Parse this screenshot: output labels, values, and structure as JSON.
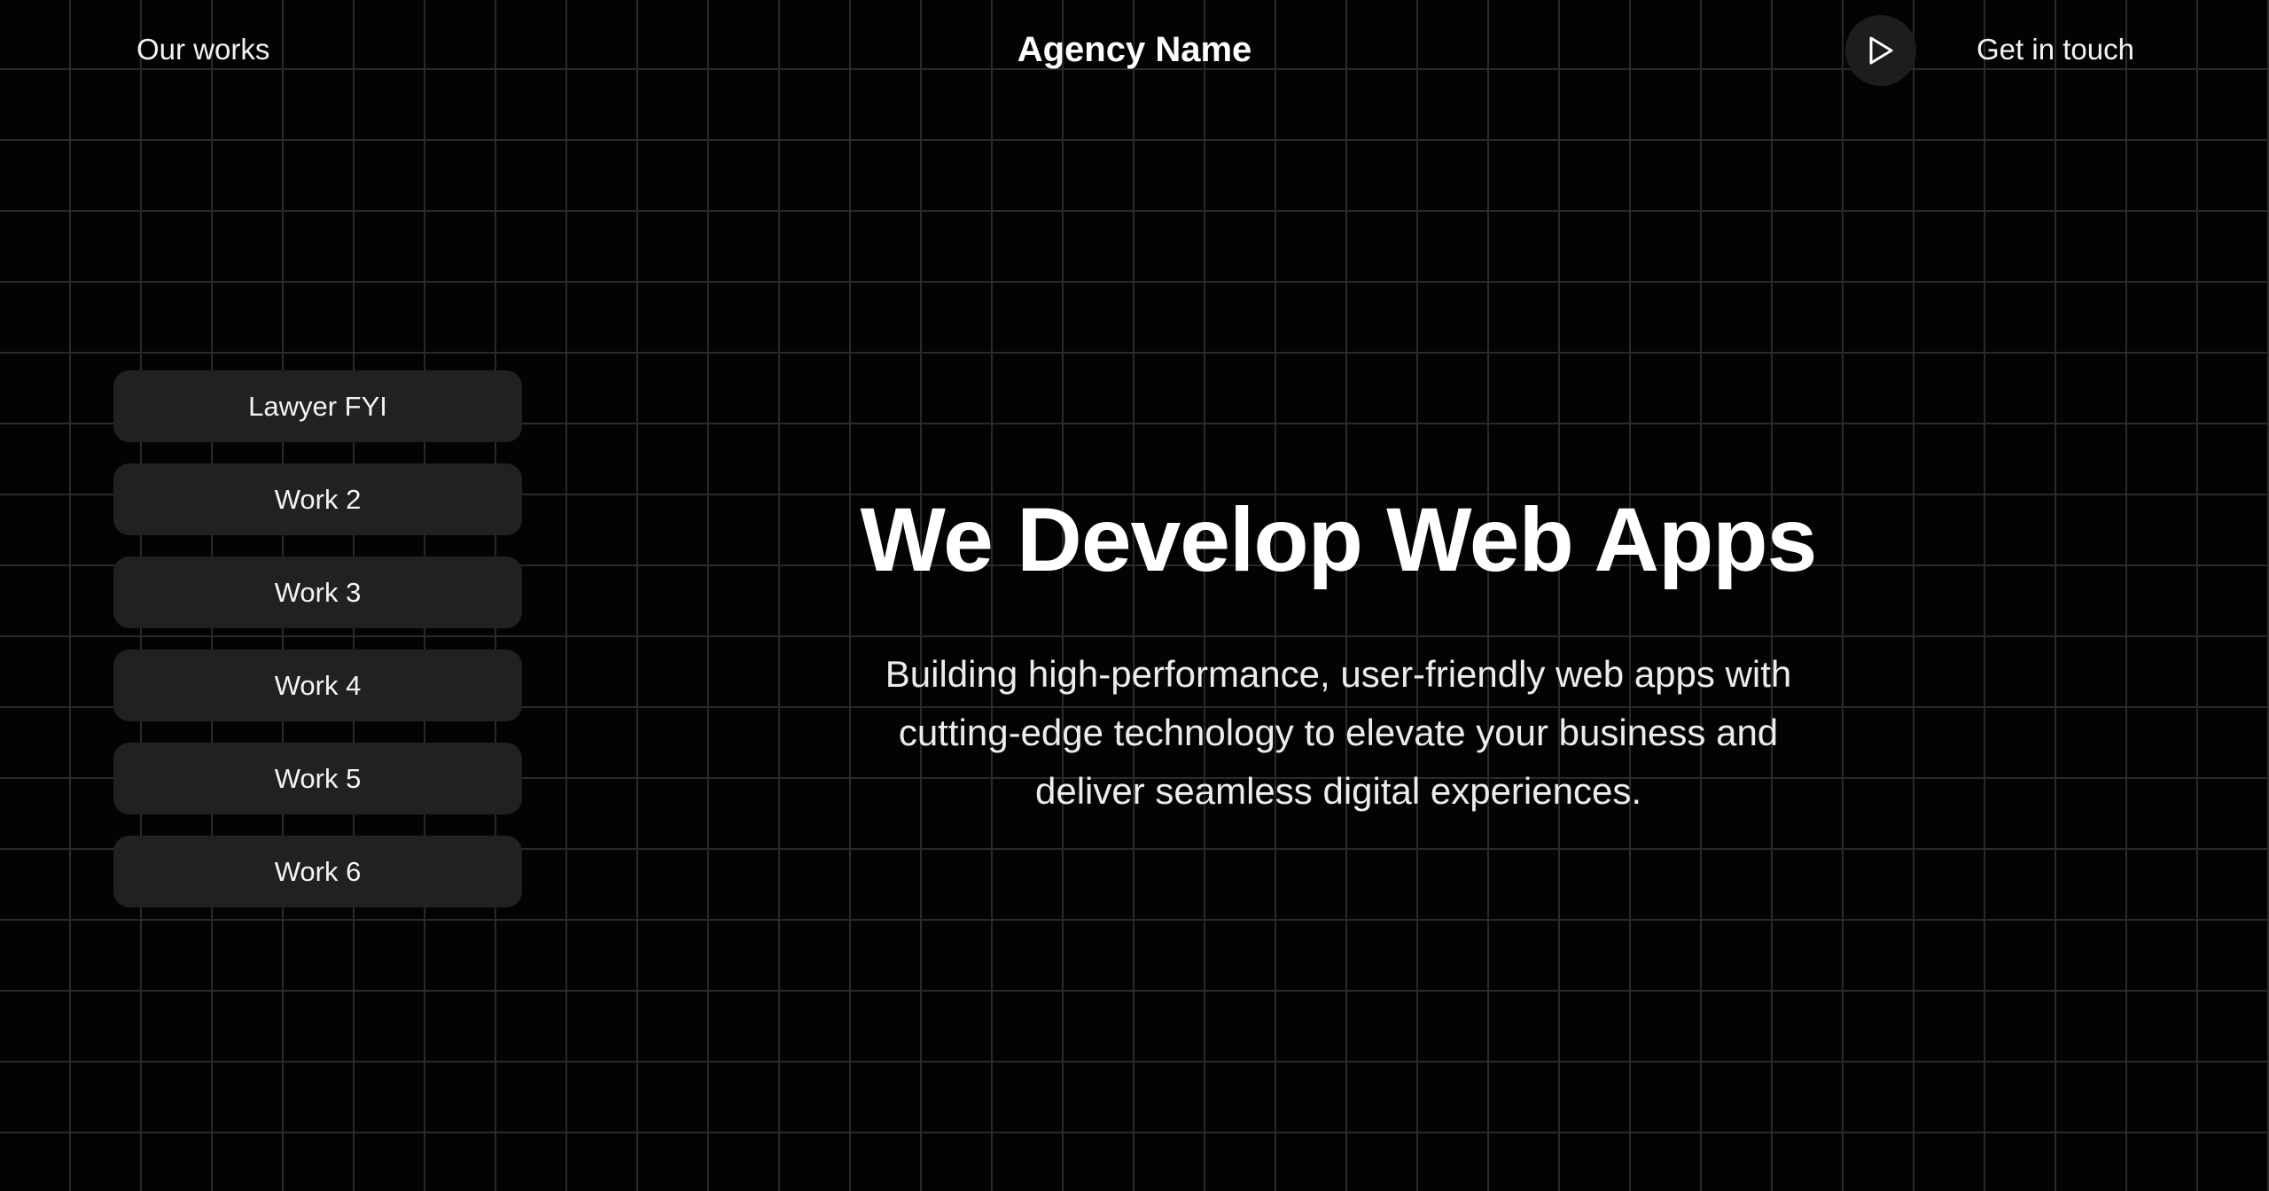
{
  "header": {
    "our_works_label": "Our works",
    "brand": "Agency Name",
    "play_icon": "play-icon",
    "contact_label": "Get in touch"
  },
  "works": {
    "items": [
      {
        "label": "Lawyer FYI"
      },
      {
        "label": "Work 2"
      },
      {
        "label": "Work 3"
      },
      {
        "label": "Work 4"
      },
      {
        "label": "Work 5"
      },
      {
        "label": "Work 6"
      }
    ]
  },
  "hero": {
    "title": "We Develop Web Apps",
    "subtitle": "Building high-performance, user-friendly web apps with cutting-edge technology to elevate your business and deliver seamless digital experiences."
  },
  "colors": {
    "background": "#030303",
    "grid_line": "#2a2a2a",
    "card": "#212121",
    "text": "#ffffff"
  }
}
